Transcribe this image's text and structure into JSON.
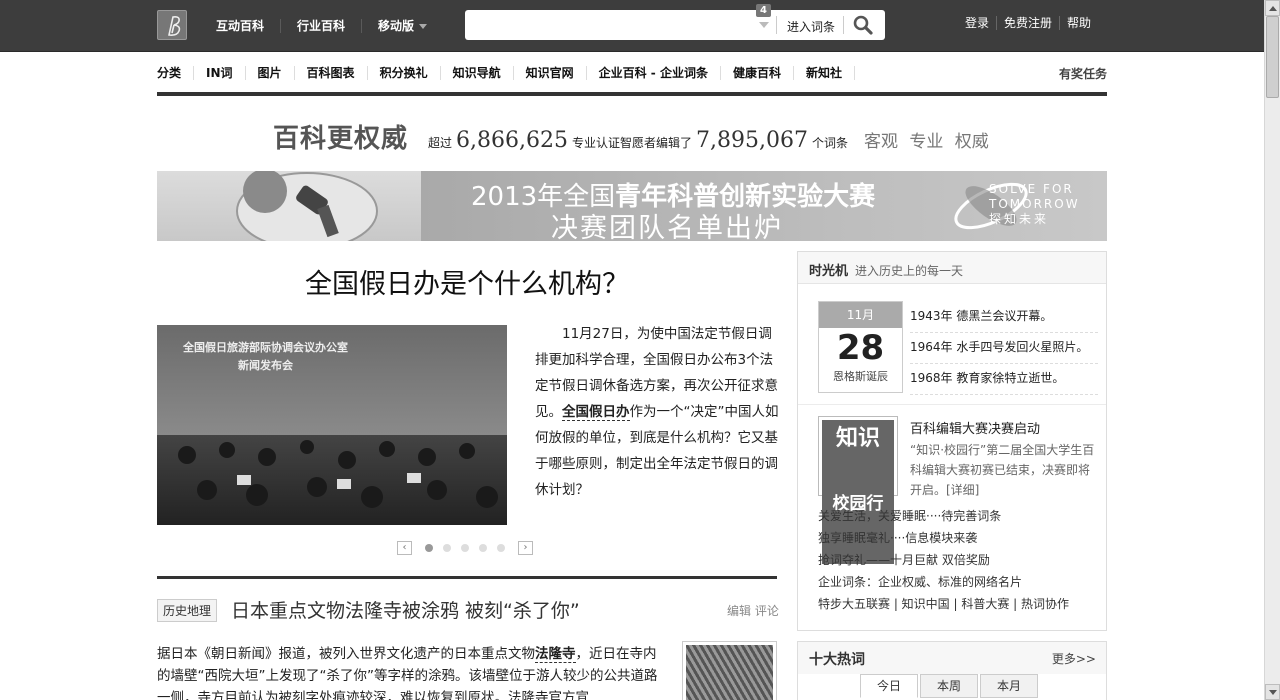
{
  "header": {
    "logo_icon": "baike-logo-icon",
    "nav": [
      "互动百科",
      "行业百科",
      "移动版"
    ],
    "search": {
      "placeholder": "",
      "badge": "4",
      "enter_label": "进入词条",
      "button_icon": "search-icon"
    },
    "links": [
      "登录",
      "免费注册",
      "帮助"
    ]
  },
  "subnav": {
    "items": [
      "分类",
      "IN词",
      "图片",
      "百科图表",
      "积分换礼",
      "知识导航",
      "知识官网",
      "企业百科 - 企业词条",
      "健康百科",
      "新知社"
    ],
    "reward": "有奖任务"
  },
  "slogan": {
    "title": "百科更权威",
    "pre": "超过",
    "editors": "6,866,625",
    "mid": "专业认证智愿者编辑了",
    "entries": "7,895,067",
    "post": "个词条",
    "tags": "客观 专业 权威"
  },
  "banner": {
    "line1_pre": "2013年全国",
    "line1_bold": "青年科普创新实验大赛",
    "line2": "决赛团队名单出炉",
    "brand1": "SOLVE FOR",
    "brand2": "TOMORROW",
    "brand3": "探知未来"
  },
  "feature": {
    "title": "全国假日办是个什么机构？",
    "photo_sign_1": "全国假日旅游部际协调会议办公室",
    "photo_sign_2": "新闻发布会",
    "text_pre": "11月27日，为使中国法定节假日调排更加科学合理，全国假日办公布3个法定节假日调休备选方案，再次公开征求意见。",
    "text_link": "全国假日办",
    "text_post": "作为一个“决定”中国人如何放假的单位，到底是什么机构？它又基于哪些原则，制定出全年法定节假日的调休计划？"
  },
  "pager": {
    "prev": "‹",
    "next": "›",
    "total": 5,
    "active": 1
  },
  "article": {
    "category": "历史地理",
    "title": "日本重点文物法隆寺被涂鸦 被刻“杀了你”",
    "edit": "编辑",
    "comment": "评论",
    "text_pre": "据日本《朝日新闻》报道，被列入世界文化遗产的日本重点文物",
    "text_link": "法隆寺",
    "text_post": "，近日在寺内的墙壁“西院大垣”上发现了“杀了你”等字样的涂鸦。该墙壁位于游人较少的公共道路一侧，寺方目前认为被刻字处痕迹较深，难以恢复到原状。法隆寺官方宣"
  },
  "timemachine": {
    "title": "时光机",
    "subtitle": "进入历史上的每一天",
    "month": "11月",
    "day": "28",
    "note": "恩格斯诞辰",
    "events": [
      "1943年 德黑兰会议开幕。",
      "1964年 水手四号发回火星照片。",
      "1968年 教育家徐特立逝世。"
    ],
    "promo_img_line1": "知识",
    "promo_img_line2": "校园行",
    "promo_title": "百科编辑大赛决赛启动",
    "promo_desc": "“知识·校园行”第二届全国大学生百科编辑大赛初赛已结束，决赛即将开启。[详细]",
    "links": [
      "关爱生活，关爱睡眠····待完善词条",
      "独享睡眠毫礼····信息模块来袭",
      "抢词夺礼——十月巨献 双倍奖励",
      "企业词条：企业权威、标准的网络名片",
      "特步大五联赛 | 知识中国 | 科普大赛 | 热词协作"
    ]
  },
  "hotwords": {
    "title": "十大热词",
    "more": "更多>>",
    "tabs": [
      "今日",
      "本周",
      "本月"
    ]
  }
}
